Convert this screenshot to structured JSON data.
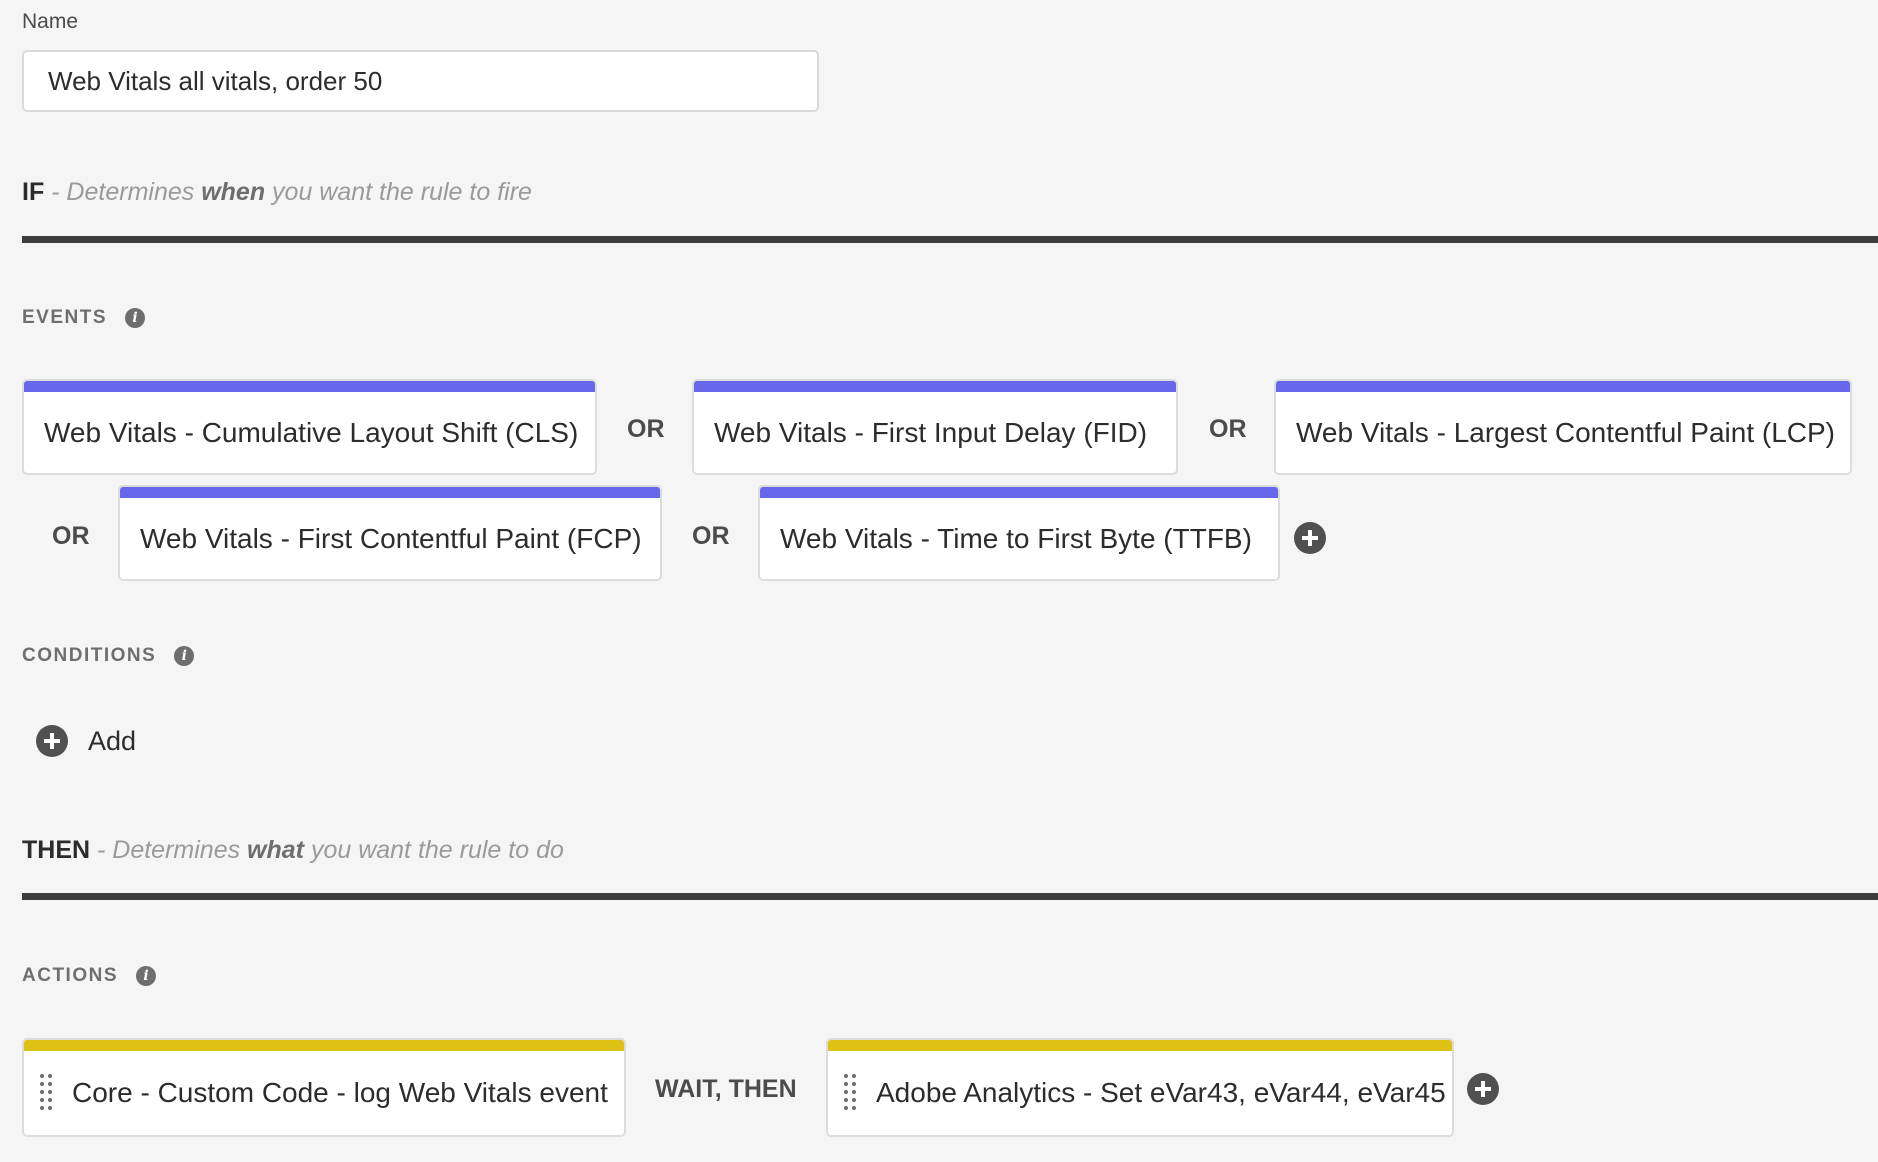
{
  "name_field": {
    "label": "Name",
    "value": "Web Vitals all vitals, order 50"
  },
  "if_section": {
    "keyword": "IF",
    "prefix": " - Determines ",
    "emphasis": "when",
    "suffix": " you want the rule to fire"
  },
  "events": {
    "heading": "EVENTS",
    "info_icon": "info-icon",
    "items": [
      {
        "label": "Web Vitals - Cumulative Layout Shift (CLS)"
      },
      {
        "label": "Web Vitals - First Input Delay (FID)"
      },
      {
        "label": "Web Vitals - Largest Contentful Paint (LCP)"
      },
      {
        "label": "Web Vitals - First Contentful Paint (FCP)"
      },
      {
        "label": "Web Vitals - Time to First Byte (TTFB)"
      }
    ],
    "connector": "OR",
    "accent_color": "#6767ec"
  },
  "conditions": {
    "heading": "CONDITIONS",
    "info_icon": "info-icon",
    "add_label": "Add"
  },
  "then_section": {
    "keyword": "THEN",
    "prefix": " - Determines ",
    "emphasis": "what",
    "suffix": " you want the rule to do"
  },
  "actions": {
    "heading": "ACTIONS",
    "info_icon": "info-icon",
    "items": [
      {
        "label": "Core - Custom Code - log Web Vitals event"
      },
      {
        "label": "Adobe Analytics - Set eVar43, eVar44, eVar45"
      }
    ],
    "connector": "WAIT, THEN",
    "accent_color": "#dfc116"
  }
}
